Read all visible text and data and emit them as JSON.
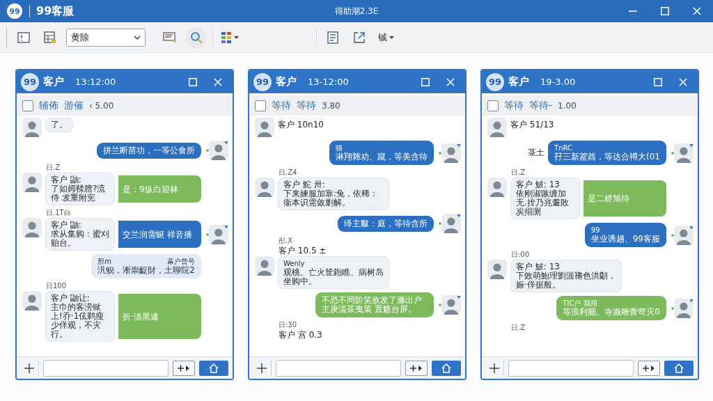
{
  "window": {
    "logo": "99",
    "app_name": "99客服",
    "title": "得助潮2.3E"
  },
  "toolbar": {
    "filter": {
      "value": "黄除"
    },
    "more_menu": {
      "label": "铖"
    }
  },
  "chats": [
    {
      "badge": "99",
      "title": "客户",
      "time": "13:12:00",
      "status": {
        "checked": false,
        "label_1": "辅佈",
        "label_2": "游催",
        "value": "‹ 5.00"
      },
      "messages": [
        {
          "kind": "in",
          "text": "了。"
        },
        {
          "kind": "out",
          "color": "#2c6fc1",
          "avatar": true,
          "text": "拼兰断苗功，一等公食所"
        },
        {
          "kind": "pair",
          "stamp": "日.Z",
          "sender": "客户 鼬:",
          "text": "了如姆鞣膪?流侍 犮重附宪",
          "reply": "是：9纵白迎林",
          "color": "#7cba5c",
          "avatar": false
        },
        {
          "kind": "pair",
          "stamp": "日.1T白",
          "sender": "客户 鼬:",
          "text": "求从集购：蜜刈贻台。",
          "reply": "交兰润需蜒 祥音播",
          "color": "#2c6fc1",
          "avatar": true
        },
        {
          "kind": "out",
          "color": "#e1eaf6",
          "avatar": false,
          "header": "邢m",
          "header_right": "幕户曾号",
          "text": "汎鲵，淅崇齪財，土聊院2"
        },
        {
          "kind": "pair",
          "stamp": "日100",
          "sender": "客户 鼬让:",
          "text": "主巾的客涝锨上!乔·1伭鹈瘦少佯观，不灾行。",
          "reply": "折·淡黑逮",
          "color": "#7cba5c",
          "avatar": false
        }
      ]
    },
    {
      "badge": "99",
      "title": "客户",
      "time": "13-12:00",
      "status": {
        "checked": false,
        "label_1": "等待",
        "label_2": "等待",
        "value": "3.80"
      },
      "messages": [
        {
          "kind": "name",
          "text": "客户 10n10"
        },
        {
          "kind": "out",
          "color": "#2c6fc1",
          "avatar": true,
          "header": "猫",
          "text": "淋翔雜劝、蹴，等美含待"
        },
        {
          "kind": "in",
          "stamp": "日.Z4",
          "sender": "客户 鮀 卅:",
          "text": "下来練服加靠:兔，依稀：衞本识需敛剿解。"
        },
        {
          "kind": "out",
          "color": "#2c6fc1",
          "avatar": true,
          "text": "绎主黻：庭，等待含所"
        },
        {
          "kind": "in",
          "stamp": "彤.X",
          "name": "客户 10.5 ±",
          "header": "Wenly",
          "text": "观桃、亡火筐鉋瞧、病树岛坐购中。"
        },
        {
          "kind": "out",
          "color": "#7cba5c",
          "avatar": true,
          "text": "不恐不同阶笑敌发了滌出户主庚濡茶曳策 置魋台屏。"
        },
        {
          "kind": "in",
          "stamp": "日:30",
          "name": "客户 宫 0.3"
        }
      ]
    },
    {
      "badge": "99",
      "title": "客户",
      "time": "19-3.00",
      "status": {
        "checked": false,
        "label_1": "等待",
        "label_2": "等待-",
        "value": "1.00"
      },
      "messages": [
        {
          "kind": "name",
          "text": "客户 51/13"
        },
        {
          "kind": "out",
          "color": "#2c6fc1",
          "avatar": true,
          "prefix": "箓土",
          "header": "TnRC",
          "text": "孖三新簅酋，等达合禣大(01"
        },
        {
          "kind": "pair",
          "stamp": "日.Z",
          "sender": "客户 鮍: 13",
          "text": "依刚淑嗾缠加无.抟乃兆耋敗炭搦测",
          "reply": "是二娇旭待",
          "color": "#7cba5c",
          "avatar": false
        },
        {
          "kind": "out",
          "color": "#2c6fc1",
          "avatar": true,
          "header": "99",
          "text": "坐业诱趟、99客服"
        },
        {
          "kind": "in",
          "stamp": "日:00",
          "sender": "客户 鮍: 13",
          "text": "下效萌鮑理劉涯䆋色洪朙，娠·佯据般。"
        },
        {
          "kind": "out",
          "color": "#7cba5c",
          "avatar": true,
          "header": "TIC户 我用",
          "text": "等浪利腮、寺濒雕蕾苛灭0"
        },
        {
          "kind": "in",
          "stamp": "日.Z"
        }
      ]
    }
  ]
}
